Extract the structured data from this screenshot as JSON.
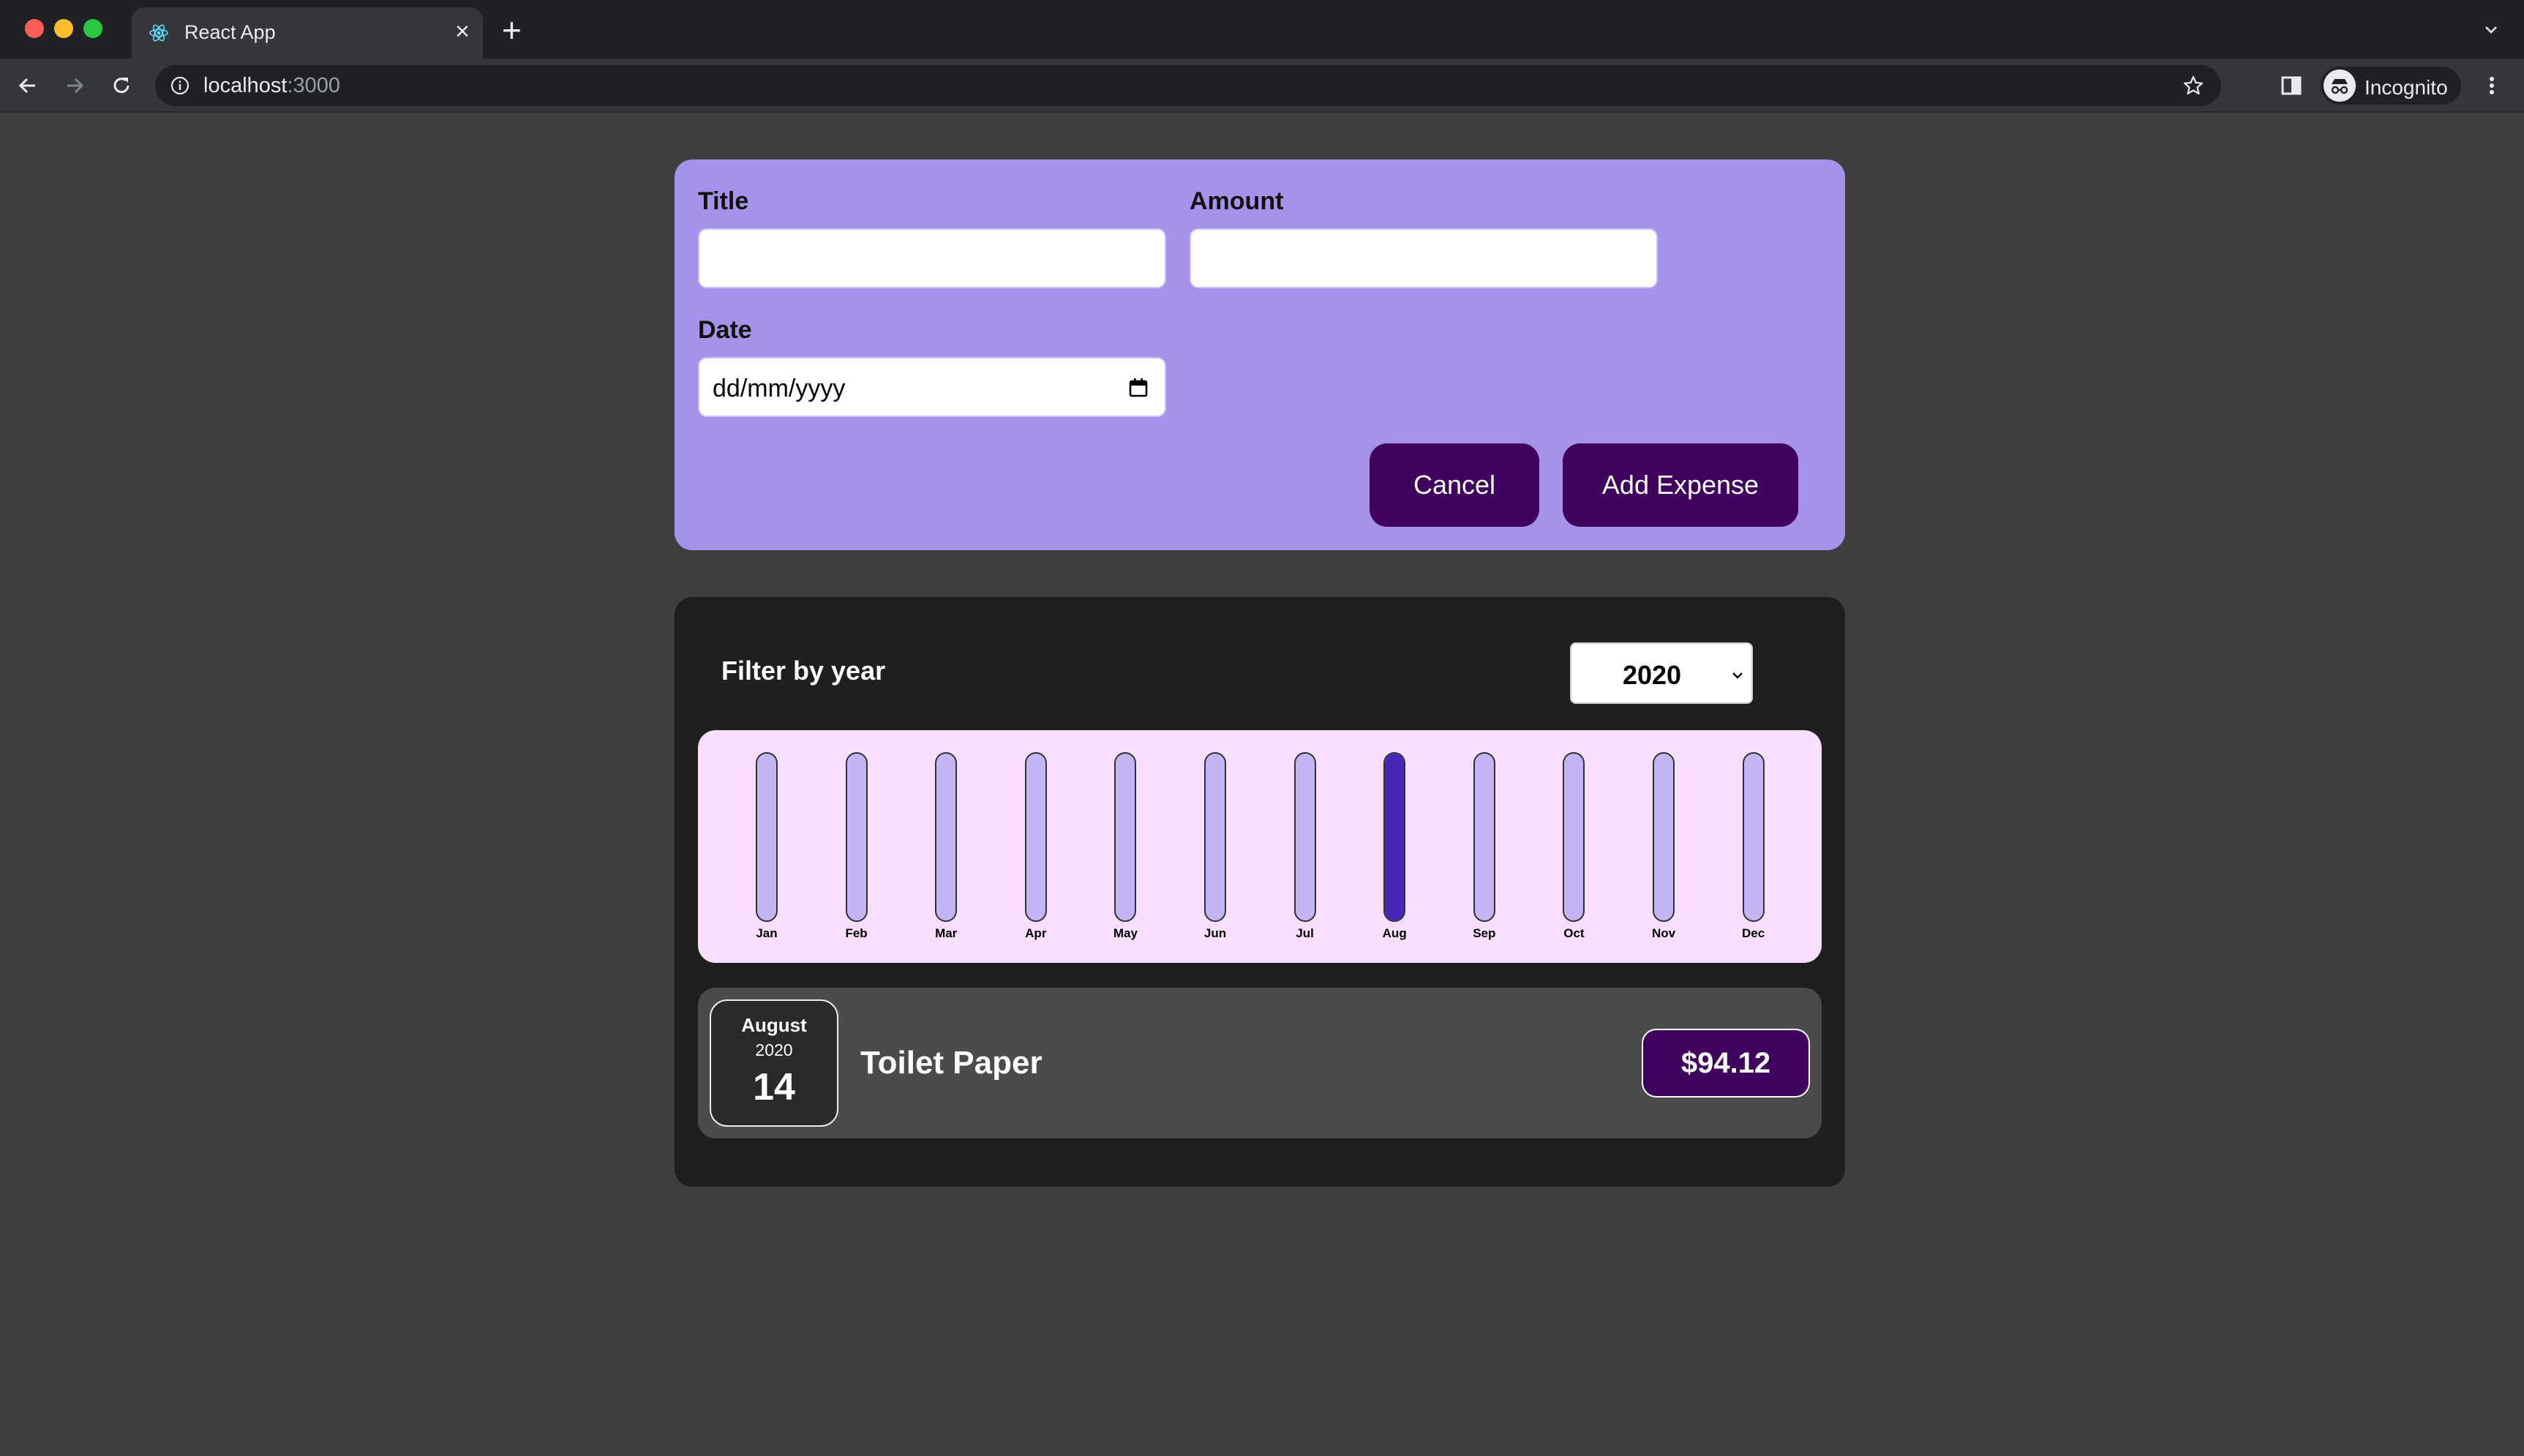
{
  "browser": {
    "tab_title": "React App",
    "url_host": "localhost",
    "url_port": ":3000",
    "profile_label": "Incognito"
  },
  "form": {
    "title_label": "Title",
    "amount_label": "Amount",
    "date_label": "Date",
    "title_value": "",
    "amount_value": "",
    "date_placeholder": "dd/mm/yyyy",
    "cancel_label": "Cancel",
    "submit_label": "Add Expense"
  },
  "filter": {
    "label": "Filter by year",
    "selected_year": "2020"
  },
  "chart_data": {
    "type": "bar",
    "categories": [
      "Jan",
      "Feb",
      "Mar",
      "Apr",
      "May",
      "Jun",
      "Jul",
      "Aug",
      "Sep",
      "Oct",
      "Nov",
      "Dec"
    ],
    "values": [
      0,
      0,
      0,
      0,
      0,
      0,
      0,
      94.12,
      0,
      0,
      0,
      0
    ],
    "ylim": [
      0,
      94.12
    ],
    "grid": false
  },
  "expenses": [
    {
      "month": "August",
      "year": "2020",
      "day": "14",
      "title": "Toilet Paper",
      "amount": "$94.12"
    }
  ],
  "colors": {
    "form_background": "#a592eb",
    "button": "#40005d",
    "chart_background": "#f8dfff",
    "bar_fill": "#4826b9",
    "bar_track": "#c3b4f3"
  }
}
